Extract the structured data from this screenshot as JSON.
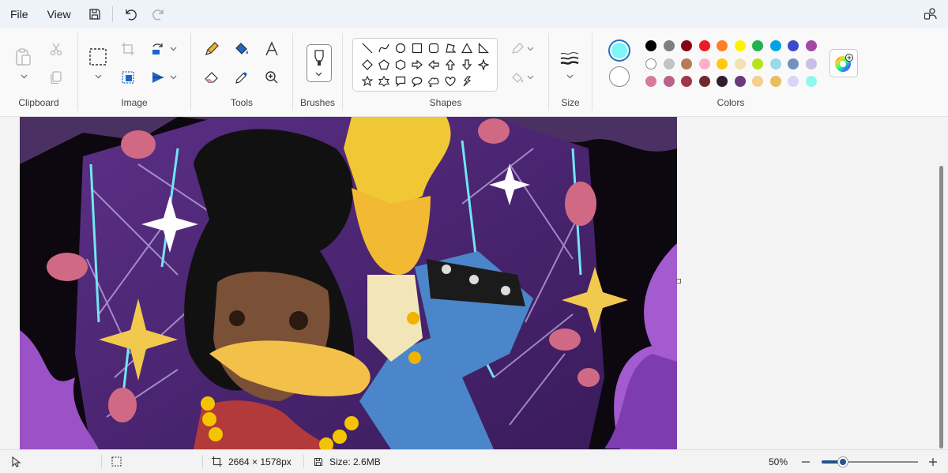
{
  "menu": {
    "file": "File",
    "view": "View"
  },
  "ribbon": {
    "groups": {
      "clipboard": "Clipboard",
      "image": "Image",
      "tools": "Tools",
      "brushes": "Brushes",
      "shapes": "Shapes",
      "size": "Size",
      "colors": "Colors"
    }
  },
  "colors": {
    "primary": "#7ff6f6",
    "secondary": "#ffffff",
    "palette_row1": [
      "#000000",
      "#7f7f7f",
      "#880015",
      "#ed1c24",
      "#ff7f27",
      "#fff200",
      "#22b14c",
      "#00a2e8",
      "#3f48cc",
      "#a349a4"
    ],
    "palette_row2": [
      "#ffffff",
      "#c3c3c3",
      "#b97a57",
      "#ffaec9",
      "#ffc90e",
      "#efe4b0",
      "#b5e61d",
      "#99d9ea",
      "#7092be",
      "#c8bfe7"
    ],
    "palette_row3": [
      "#d77b9c",
      "#b9628a",
      "#a03747",
      "#6e2b2b",
      "#2d1f2b",
      "#6b3a78",
      "#f5cf8b",
      "#e9be5b",
      "#dcd4f5",
      "#8ef7f2"
    ]
  },
  "status": {
    "dimensions": "2664 × 1578px",
    "size": "Size: 2.6MB",
    "zoom": "50%",
    "zoom_fraction": 0.22
  }
}
